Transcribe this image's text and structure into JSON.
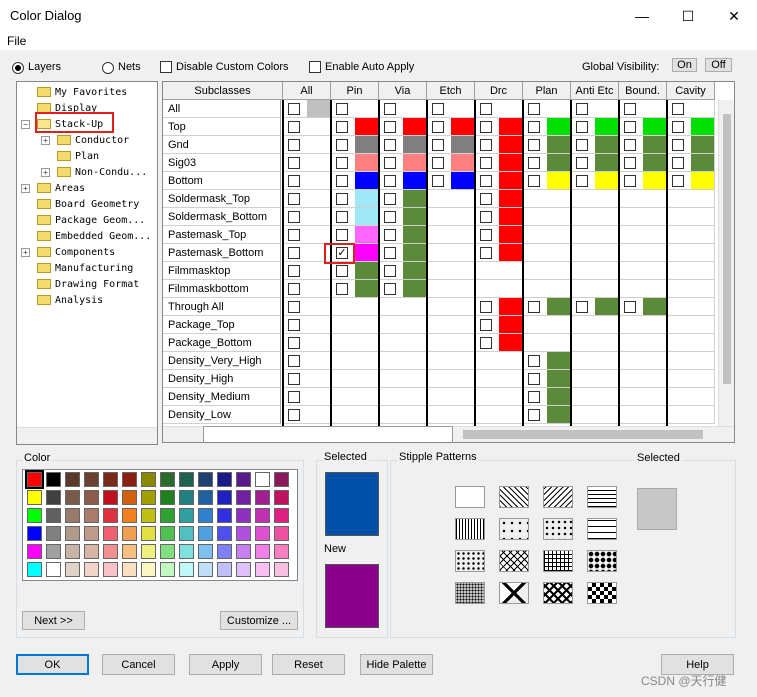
{
  "window": {
    "title": "Color Dialog",
    "minimize": "—",
    "maximize": "☐",
    "close": "✕"
  },
  "menu": {
    "file": "File"
  },
  "top": {
    "layers": "Layers",
    "nets": "Nets",
    "disable_custom": "Disable Custom Colors",
    "enable_auto": "Enable Auto Apply",
    "global_visibility": "Global Visibility:",
    "on": "On",
    "off": "Off"
  },
  "tree": [
    {
      "label": "My Favorites"
    },
    {
      "label": "Display"
    },
    {
      "label": "Stack-Up"
    },
    {
      "label": "Conductor"
    },
    {
      "label": "Plan"
    },
    {
      "label": "Non-Condu..."
    },
    {
      "label": "Areas"
    },
    {
      "label": "Board Geometry"
    },
    {
      "label": "Package Geom..."
    },
    {
      "label": "Embedded Geom..."
    },
    {
      "label": "Components"
    },
    {
      "label": "Manufacturing"
    },
    {
      "label": "Drawing Format"
    },
    {
      "label": "Analysis"
    }
  ],
  "grid": {
    "subclasses_header": "Subclasses",
    "columns": [
      "All",
      "Pin",
      "Via",
      "Etch",
      "Drc",
      "Plan",
      "Anti Etc",
      "Bound.",
      "Cavity"
    ],
    "rows": [
      "All",
      "Top",
      "Gnd",
      "Sig03",
      "Bottom",
      "Soldermask_Top",
      "Soldermask_Bottom",
      "Pastemask_Top",
      "Pastemask_Bottom",
      "Filmmasktop",
      "Filmmaskbottom",
      "Through All",
      "Package_Top",
      "Package_Bottom",
      "Density_Very_High",
      "Density_High",
      "Density_Medium",
      "Density_Low"
    ]
  },
  "colors": {
    "red": "#ff0000",
    "green": "#00e000",
    "dkgreen": "#5a8a3a",
    "gray": "#808080",
    "salmon": "#ff8080",
    "blue": "#0000ff",
    "yellow": "#ffff00",
    "cyan": "#a0e8f8",
    "magenta": "#ff00ff",
    "pink": "#ff66ff",
    "selected": "#0050a8",
    "new": "#8b008b",
    "stip_selected": "#c8c8c8"
  },
  "color_panel": {
    "label": "Color",
    "next": "Next >>",
    "customize": "Customize ..."
  },
  "selected_panel": {
    "selected": "Selected",
    "new": "New"
  },
  "stipple": {
    "label": "Stipple Patterns",
    "selected": "Selected"
  },
  "buttons": {
    "ok": "OK",
    "cancel": "Cancel",
    "apply": "Apply",
    "reset": "Reset",
    "hide_palette": "Hide Palette",
    "help": "Help"
  },
  "watermark": "CSDN @天行健"
}
